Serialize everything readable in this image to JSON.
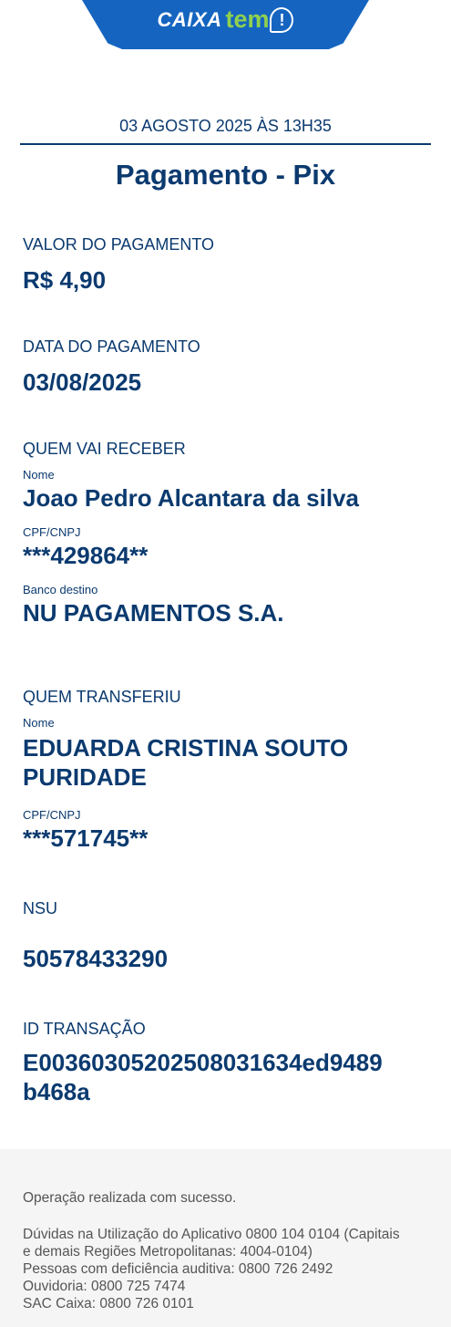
{
  "header": {
    "logo_caixa": "CAIXA",
    "logo_tem": "tem",
    "logo_bang": "!"
  },
  "receipt": {
    "datetime": "03 AGOSTO 2025 ÀS 13H35",
    "title": "Pagamento - Pix",
    "valor_label": "VALOR DO PAGAMENTO",
    "valor": "R$ 4,90",
    "data_label": "DATA DO PAGAMENTO",
    "data": "03/08/2025",
    "receiver": {
      "section_label": "QUEM VAI RECEBER",
      "nome_label": "Nome",
      "nome": "Joao Pedro Alcantara da silva",
      "cpf_label": "CPF/CNPJ",
      "cpf": "***429864**",
      "banco_label": "Banco destino",
      "banco": "NU PAGAMENTOS S.A."
    },
    "sender": {
      "section_label": "QUEM TRANSFERIU",
      "nome_label": "Nome",
      "nome_line1": "EDUARDA CRISTINA SOUTO",
      "nome_line2": "PURIDADE",
      "cpf_label": "CPF/CNPJ",
      "cpf": "***571745**"
    },
    "nsu_label": "NSU",
    "nsu": "50578433290",
    "id_label": "ID TRANSAÇÃO",
    "id_line1": "E00360305202508031634ed9489",
    "id_line2": "b468a"
  },
  "footer": {
    "status": "Operação realizada com sucesso.",
    "line1": "Dúvidas na Utilização do Aplicativo 0800 104 0104 (Capitais",
    "line2": "e demais Regiões Metropolitanas: 4004-0104)",
    "line3": "Pessoas com deficiência auditiva: 0800 726 2492",
    "line4": "Ouvidoria: 0800 725 7474",
    "line5": "SAC Caixa: 0800 726 0101"
  },
  "colors": {
    "brand_blue": "#1565c0",
    "text_navy": "#0b3a6f",
    "logo_green": "#8fd14f",
    "footer_bg": "#f5f5f5"
  }
}
